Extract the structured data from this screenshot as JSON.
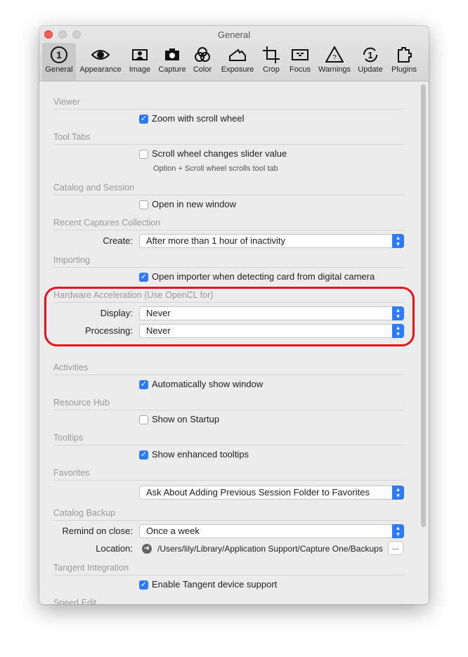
{
  "window": {
    "title": "General"
  },
  "toolbar": [
    {
      "label": "General",
      "icon": "general-1-icon"
    },
    {
      "label": "Appearance",
      "icon": "eye-icon"
    },
    {
      "label": "Image",
      "icon": "image-portrait-icon"
    },
    {
      "label": "Capture",
      "icon": "camera-icon"
    },
    {
      "label": "Color",
      "icon": "color-circles-icon"
    },
    {
      "label": "Exposure",
      "icon": "histogram-icon"
    },
    {
      "label": "Crop",
      "icon": "crop-icon"
    },
    {
      "label": "Focus",
      "icon": "focus-icon"
    },
    {
      "label": "Warnings",
      "icon": "warning-icon"
    },
    {
      "label": "Update",
      "icon": "update-icon"
    },
    {
      "label": "Plugins",
      "icon": "puzzle-icon"
    }
  ],
  "sections": {
    "viewer": "Viewer",
    "tool_tabs": "Tool Tabs",
    "catalog_session": "Catalog and Session",
    "recent": "Recent Captures Collection",
    "importing": "Importing",
    "hw": "Hardware Acceleration (Use OpenCL for)",
    "activities": "Activities",
    "resource_hub": "Resource Hub",
    "tooltips": "Tooltips",
    "favorites": "Favorites",
    "catalog_backup": "Catalog Backup",
    "tangent": "Tangent Integration",
    "speed_edit": "Speed Edit"
  },
  "checks": {
    "zoom": {
      "label": "Zoom with scroll wheel",
      "checked": true
    },
    "scroll_slider": {
      "label": "Scroll wheel changes slider value",
      "checked": false
    },
    "new_window": {
      "label": "Open in new window",
      "checked": false
    },
    "importer": {
      "label": "Open importer when detecting card from digital camera",
      "checked": true
    },
    "auto_show": {
      "label": "Automatically show window",
      "checked": true
    },
    "startup": {
      "label": "Show on Startup",
      "checked": false
    },
    "tooltips": {
      "label": "Show enhanced tooltips",
      "checked": true
    },
    "tangent": {
      "label": "Enable Tangent device support",
      "checked": true
    }
  },
  "hint": "Option + Scroll wheel scrolls tool tab",
  "fields": {
    "create": {
      "label": "Create:",
      "value": "After more than 1 hour of inactivity"
    },
    "display": {
      "label": "Display:",
      "value": "Never"
    },
    "processing": {
      "label": "Processing:",
      "value": "Never"
    },
    "favorites": {
      "value": "Ask About Adding Previous Session Folder to Favorites"
    },
    "remind": {
      "label": "Remind on close:",
      "value": "Once a week"
    },
    "location": {
      "label": "Location:",
      "value": "/Users/lily/Library/Application Support/Capture One/Backups",
      "browse": "..."
    }
  },
  "colors": {
    "accent": "#2f7bf6",
    "highlight": "#e8141c"
  }
}
